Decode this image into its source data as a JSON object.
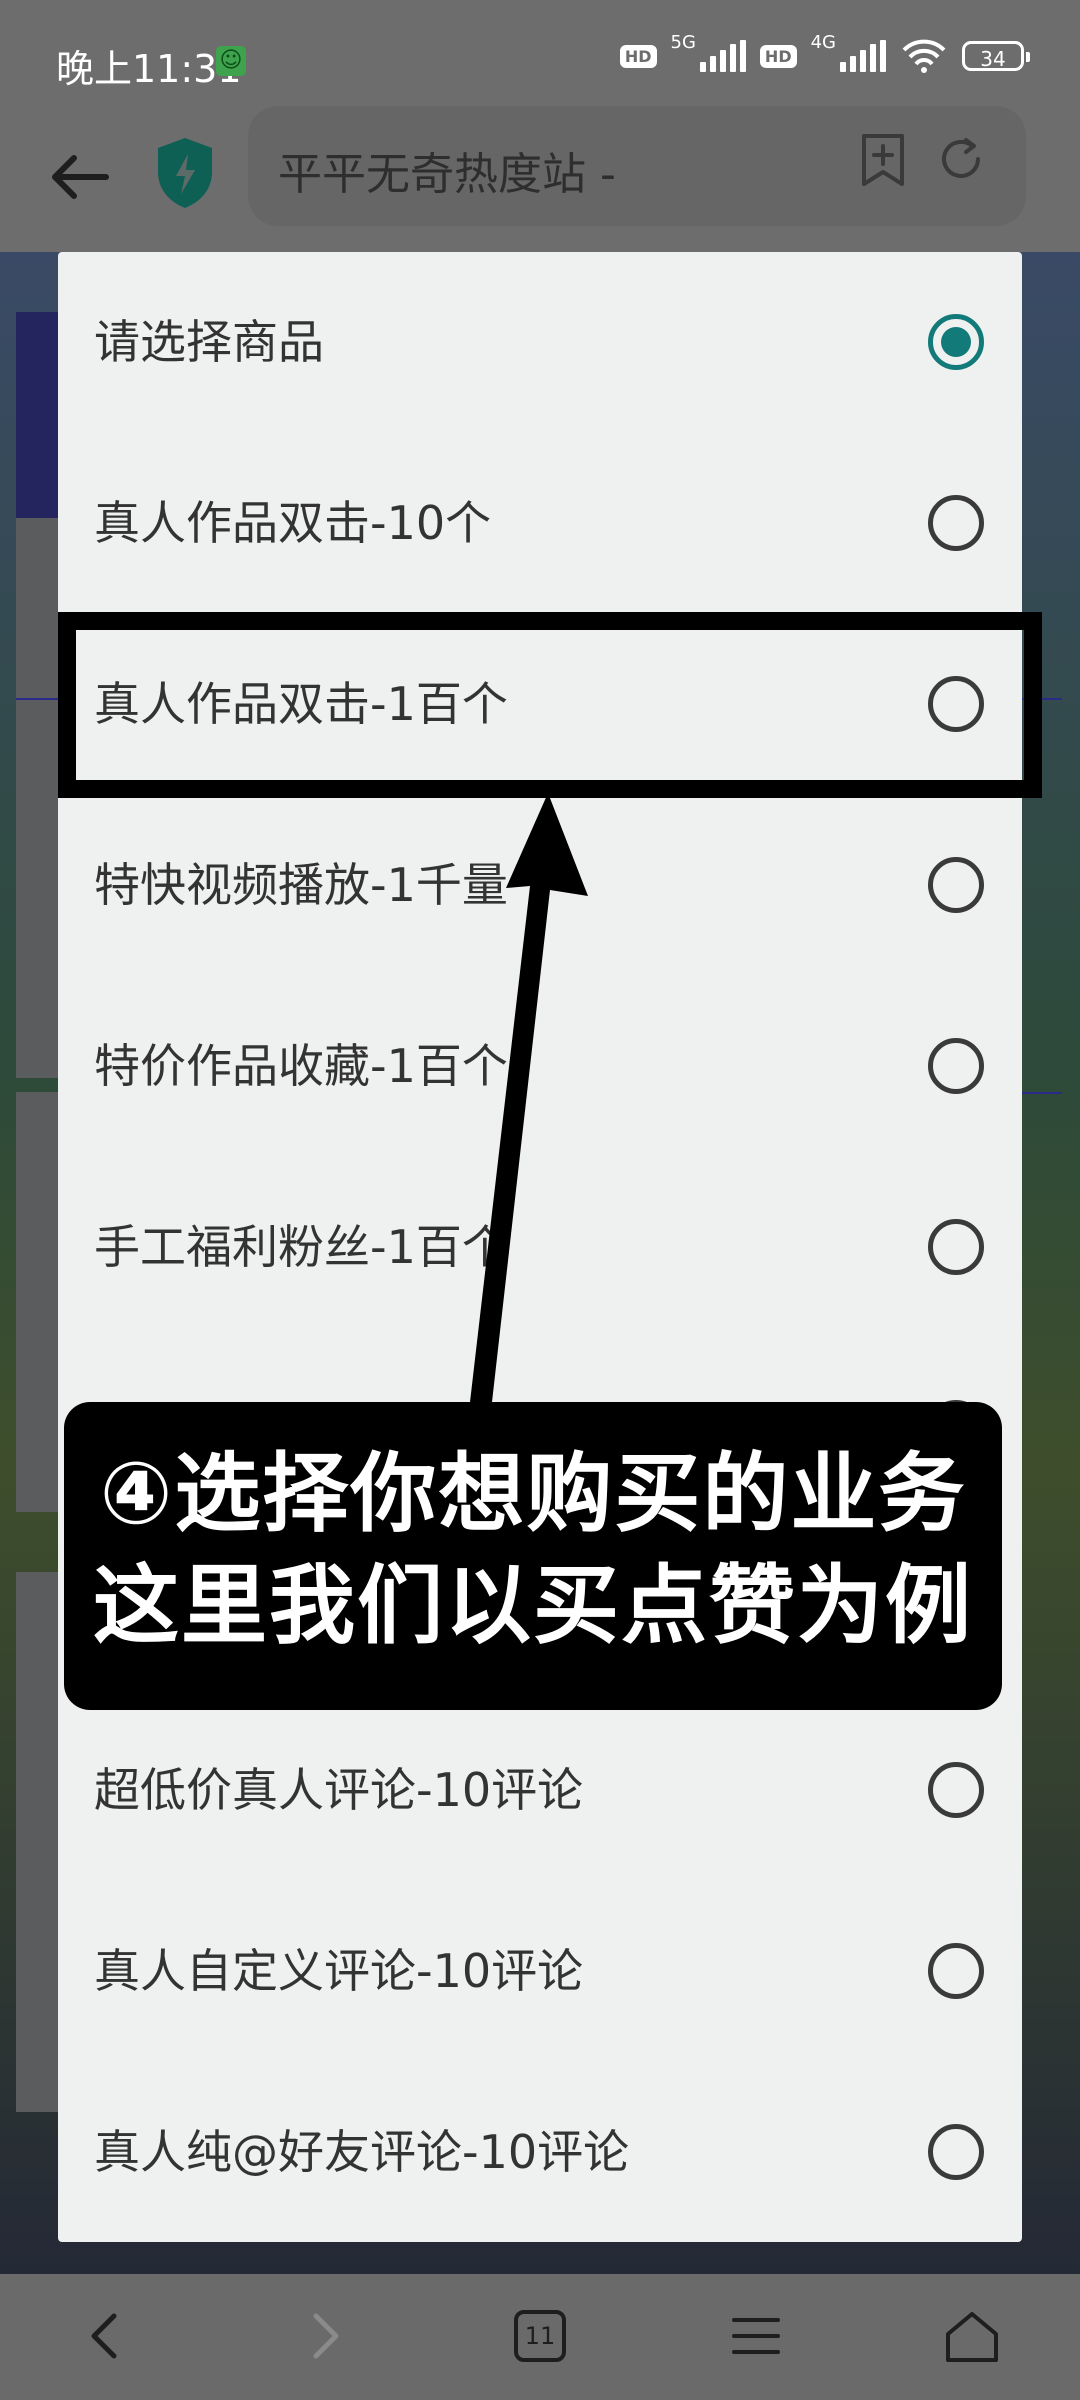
{
  "status_bar": {
    "time": "晚上11:31",
    "net_primary": "5G",
    "net_secondary": "4G",
    "hd_label": "HD",
    "battery": "34"
  },
  "toolbar": {
    "url_title": "平平无奇热度站 -"
  },
  "dialog": {
    "options": [
      {
        "label": "请选择商品",
        "selected": true
      },
      {
        "label": "真人作品双击-10个",
        "selected": false
      },
      {
        "label": "真人作品双击-1百个",
        "selected": false
      },
      {
        "label": "特快视频播放-1千量",
        "selected": false
      },
      {
        "label": "特价作品收藏-1百个",
        "selected": false
      },
      {
        "label": "手工福利粉丝-1百个",
        "selected": false
      },
      {
        "label": "",
        "selected": false
      },
      {
        "label": "",
        "selected": false
      },
      {
        "label": "超低价真人评论-10评论",
        "selected": false
      },
      {
        "label": "真人自定义评论-10评论",
        "selected": false
      },
      {
        "label": "真人纯@好友评论-10评论",
        "selected": false
      }
    ]
  },
  "annotation": {
    "line1": "④选择你想购买的业务",
    "line2": "这里我们以买点赞为例"
  },
  "bottom_nav": {
    "tabs_count": "11"
  },
  "colors": {
    "radio_selected": "#137a7a",
    "dialog_bg": "#eff0f0",
    "scrim": "#6d6d6d"
  }
}
